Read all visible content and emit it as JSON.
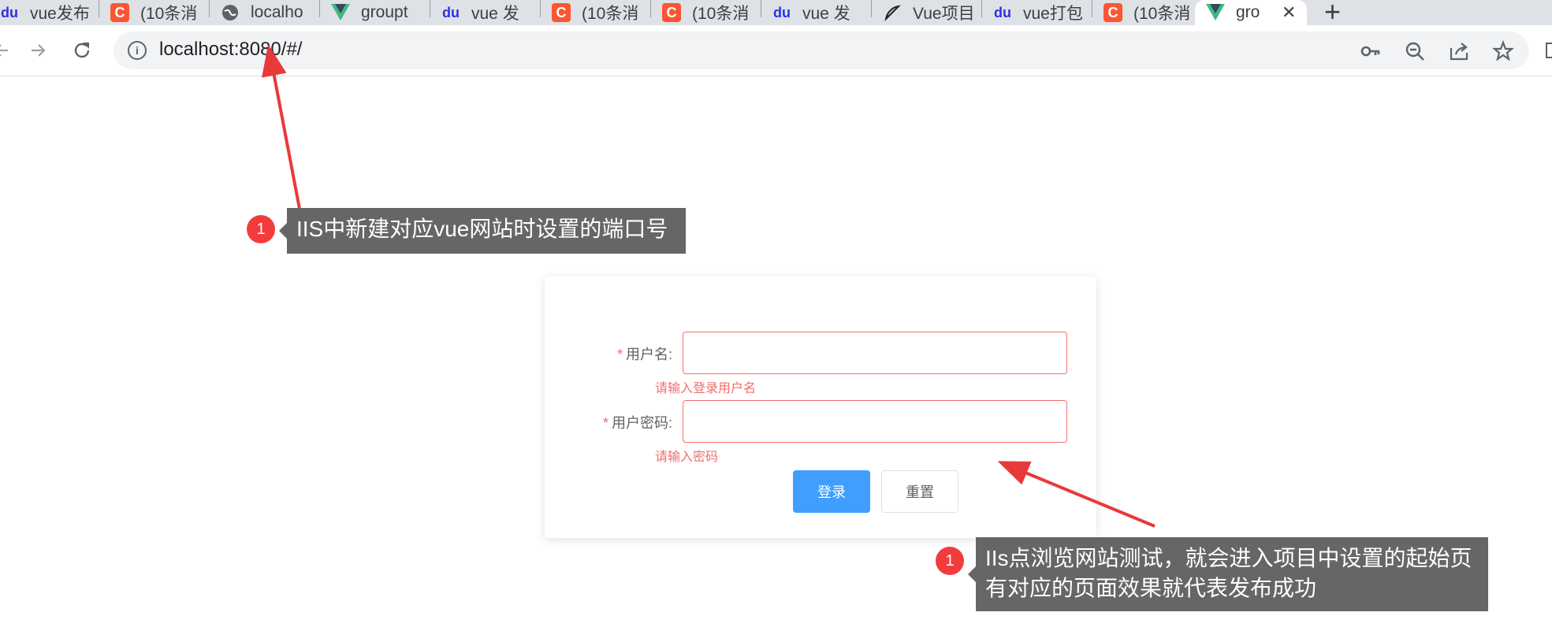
{
  "browser": {
    "tabs": [
      {
        "label": "vue发布",
        "icon": "baidu-icon"
      },
      {
        "label": "(10条消",
        "icon": "csdn-c-icon"
      },
      {
        "label": "localho",
        "icon": "globe-icon"
      },
      {
        "label": "groupt",
        "icon": "vue-icon"
      },
      {
        "label": "vue 发",
        "icon": "baidu-icon"
      },
      {
        "label": "(10条消",
        "icon": "csdn-c-icon"
      },
      {
        "label": "(10条消",
        "icon": "csdn-c-icon"
      },
      {
        "label": "vue 发",
        "icon": "baidu-icon"
      },
      {
        "label": "Vue项目",
        "icon": "feather-icon"
      },
      {
        "label": "vue打包",
        "icon": "baidu-icon"
      },
      {
        "label": "(10条消",
        "icon": "csdn-c-icon"
      }
    ],
    "active_tab": {
      "label": "gro",
      "icon": "vue-icon"
    },
    "close_glyph": "✕",
    "new_tab_glyph": "+",
    "url": "localhost:8080/#/"
  },
  "login": {
    "username_label": "用户名:",
    "password_label": "用户密码:",
    "required_mark": "*",
    "username_value": "",
    "password_value": "",
    "username_error": "请输入登录用户名",
    "password_error": "请输入密码",
    "login_button": "登录",
    "reset_button": "重置"
  },
  "annotations": {
    "top": {
      "badge": "1",
      "text": "IIS中新建对应vue网站时设置的端口号"
    },
    "bottom": {
      "badge": "1",
      "line1": "IIs点浏览网站测试，就会进入项目中设置的起始页",
      "line2": "有对应的页面效果就代表发布成功"
    }
  },
  "colors": {
    "primary": "#409eff",
    "error": "#f56c6c",
    "annotation_bg": "#666666",
    "badge": "#f23c3c",
    "arrow": "#e8393b"
  }
}
